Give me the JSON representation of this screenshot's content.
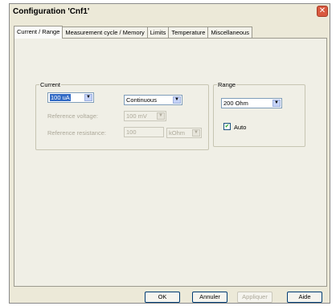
{
  "window": {
    "title": "Configuration 'Cnf1'"
  },
  "tabs": [
    {
      "label": "Current / Range"
    },
    {
      "label": "Measurement cycle / Memory"
    },
    {
      "label": "Limits"
    },
    {
      "label": "Temperature"
    },
    {
      "label": "Miscellaneous"
    }
  ],
  "current": {
    "legend": "Current",
    "value": "100 uA",
    "mode": "Continuous",
    "ref_voltage_label": "Reference voltage:",
    "ref_voltage_value": "100 mV",
    "ref_resistance_label": "Reference resistance:",
    "ref_resistance_value": "100",
    "ref_resistance_unit": "kOhm"
  },
  "range": {
    "legend": "Range",
    "value": "200 Ohm",
    "auto_label": "Auto",
    "auto_checked": true
  },
  "buttons": {
    "ok": "OK",
    "cancel": "Annuler",
    "apply": "Appliquer",
    "help": "Aide"
  }
}
